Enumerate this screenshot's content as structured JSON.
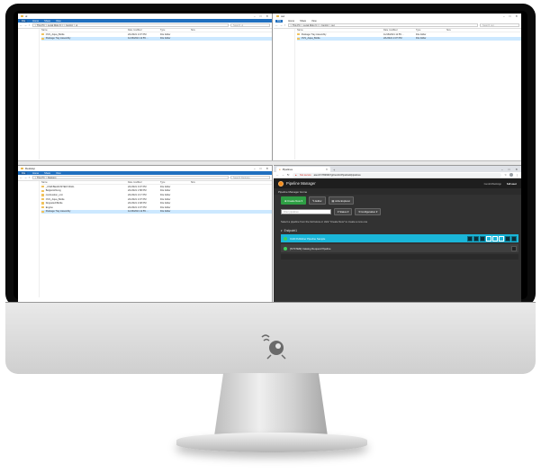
{
  "explorer1": {
    "title": "ui",
    "ribbon": [
      "File",
      "Home",
      "Share",
      "View"
    ],
    "address": "> This PC > Local Disk (C:) > Centric > ui",
    "search_placeholder": "Search ui",
    "columns": [
      "Name",
      "Date modified",
      "Type",
      "Size"
    ],
    "rows": [
      {
        "name": "CVS_Aqua_Bottle",
        "date": "2/1/2021 2:37 PM",
        "type": "File folder",
        "selected": false
      },
      {
        "name": "Package Tray Assembly",
        "date": "11/16/2021 11:55 ...",
        "type": "File folder",
        "selected": true
      }
    ],
    "status": "2 items    1 item selected"
  },
  "explorer2": {
    "title": "out",
    "ribbon": [
      "File",
      "Home",
      "Share",
      "View"
    ],
    "address": "> This PC > Local Disk (C:) > Centric > out",
    "search_placeholder": "Search out",
    "columns": [
      "Name",
      "Date modified",
      "Type",
      "Size"
    ],
    "rows": [
      {
        "name": "Package Tray Assembly",
        "date": "11/16/2021 11:55 ...",
        "type": "File folder",
        "selected": false
      },
      {
        "name": "CVS_Aqua_Bottle",
        "date": "2/1/2021 2:37 PM",
        "type": "File folder",
        "selected": true
      }
    ],
    "status": "2 items"
  },
  "explorer3": {
    "title": "Desktop",
    "ribbon": [
      "File",
      "Home",
      "Share",
      "View"
    ],
    "address": "> This PC > Desktop",
    "search_placeholder": "Search Desktop",
    "columns": [
      "Name",
      "Date modified",
      "Type",
      "Size"
    ],
    "rows": [
      {
        "name": "_CSM BEAKOSTER FINAL",
        "date": "2/1/2021 3:37 PM",
        "type": "File folder",
        "selected": false
      },
      {
        "name": "Belgienichtung",
        "date": "2/1/2021 1:58 PM",
        "type": "File folder",
        "selected": false
      },
      {
        "name": "combustion_unit",
        "date": "2/1/2021 2:17 PM",
        "type": "File folder",
        "selected": false
      },
      {
        "name": "CVS_Aqua_Bottle",
        "date": "2/1/2021 2:37 PM",
        "type": "File folder",
        "selected": false
      },
      {
        "name": "DoppelschBottle",
        "date": "2/1/2021 2:48 PM",
        "type": "File folder",
        "selected": false
      },
      {
        "name": "Engine",
        "date": "2/1/2021 2:37 PM",
        "type": "File folder",
        "selected": false
      },
      {
        "name": "Package Tray Assembly",
        "date": "11/16/2021 11:55 ...",
        "type": "File folder",
        "selected": true
      }
    ]
  },
  "browser": {
    "tab_title": "Pipelines",
    "new_tab": "+",
    "security": "Not secure",
    "url": "ase-07c78d93b7g/Centric/Pipeline#/pipelines"
  },
  "pipeline_manager": {
    "title": "Pipeline Manager",
    "context_label": "CentricWebApp",
    "user": "full user",
    "subtitle": "Pipeline Manager Home",
    "toolbar": {
      "create": "Create New",
      "editor": "Editor",
      "explorer": "Jobs Explorer"
    },
    "filter_placeholder": "Filter pipelines",
    "status_button": "Status",
    "config_button": "Configuration",
    "help": "Select a pipeline from the list below or click \"Create New\" to create a new one",
    "group": "Endpoint1",
    "pipelines": [
      {
        "name": "CAD Publisher Pipeline Sample",
        "active": true
      },
      {
        "name": "[SYSTEM] Catalog Request Pipeline",
        "active": false
      }
    ]
  },
  "colors": {
    "accent": "#1ab6d9",
    "ok": "#3ecf5b",
    "create": "#2e9e44",
    "brand": "#f28a1a"
  }
}
